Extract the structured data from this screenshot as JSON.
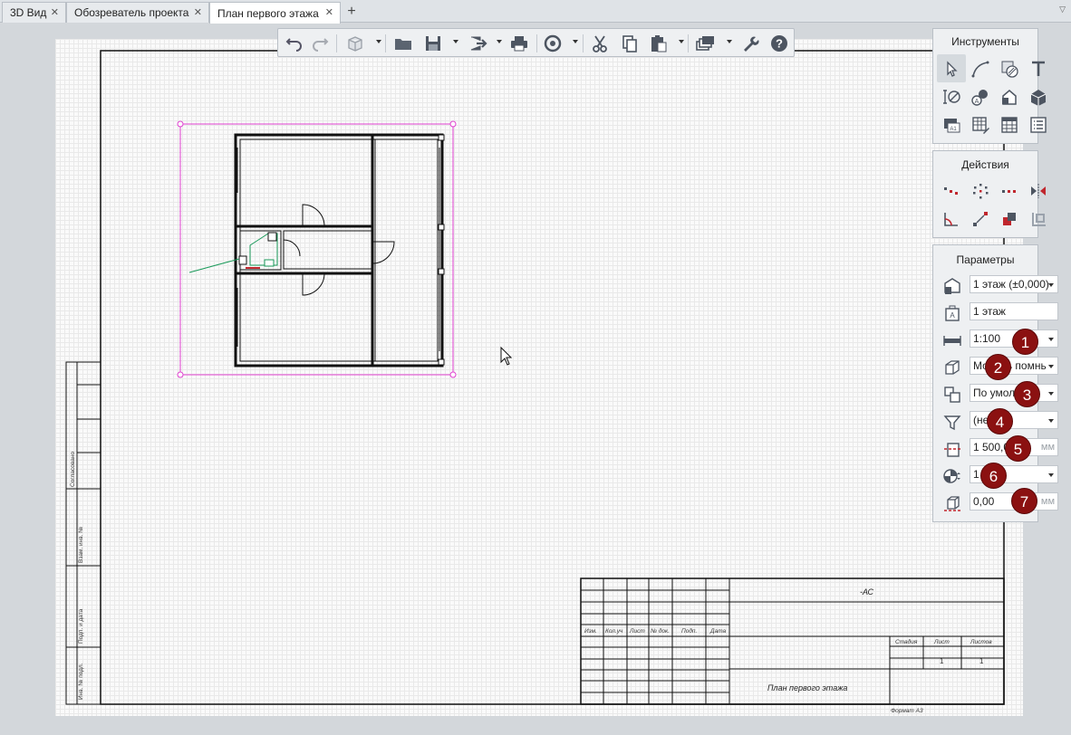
{
  "tabs": [
    {
      "label": "3D Вид",
      "close": "✕"
    },
    {
      "label": "Обозреватель проекта",
      "close": "✕"
    },
    {
      "label": "План первого этажа",
      "close": "✕",
      "active": true
    }
  ],
  "tab_add": "+",
  "tab_menu": "▽",
  "toolbar": {
    "icons": [
      "undo-icon",
      "redo-icon",
      "3d-box-icon",
      "open-folder-icon",
      "save-icon",
      "export-icon",
      "print-icon",
      "sync-icon",
      "cut-icon",
      "copy-icon",
      "paste-icon",
      "views-icon",
      "settings-wrench-icon",
      "help-icon"
    ]
  },
  "tools_panel": {
    "title": "Инструменты",
    "icons": [
      "select-arrow-icon",
      "line-tool-icon",
      "hatch-tool-icon",
      "text-tool-icon",
      "dimension-icon",
      "annotation-icon",
      "elevation-mark-icon",
      "building-3d-icon",
      "sheet-label-icon",
      "table-edit-icon",
      "table-icon",
      "list-icon"
    ]
  },
  "actions_panel": {
    "title": "Действия",
    "icons": [
      "move-icon",
      "rotate-copy-icon",
      "array-icon",
      "mirror-icon",
      "angle-icon",
      "scale-icon",
      "union-icon",
      "offset-icon"
    ]
  },
  "params_panel": {
    "title": "Параметры",
    "rows": [
      {
        "icon": "floor-level-icon",
        "value": "1 этаж (±0,000)",
        "type": "select"
      },
      {
        "icon": "label-icon",
        "value": "1 этаж",
        "type": "text"
      },
      {
        "icon": "scale-ruler-icon",
        "value": "1:100",
        "type": "select"
      },
      {
        "icon": "model-box-icon",
        "value": "Модель помнь",
        "type": "select"
      },
      {
        "icon": "view-template-icon",
        "value": "По умолч",
        "type": "select"
      },
      {
        "icon": "filter-icon",
        "value": "(нет)",
        "type": "select"
      },
      {
        "icon": "cut-height-icon",
        "value": "1 500,00",
        "type": "unit",
        "unit": "мм"
      },
      {
        "icon": "detail-level-icon",
        "value": "1",
        "type": "select"
      },
      {
        "icon": "depth-icon",
        "value": "0,00",
        "type": "unit",
        "unit": "мм"
      }
    ]
  },
  "badges": [
    "1",
    "2",
    "3",
    "4",
    "5",
    "6",
    "7"
  ],
  "colors": {
    "badge": "#8b1111",
    "selection": "#e040d0",
    "accent_green": "#1a9a5a"
  },
  "title_block": {
    "code": "-АС",
    "sheet_name": "План первого этажа",
    "format": "Формат А3",
    "stage_header": "Стадия",
    "sheet_header": "Лист",
    "sheets_header": "Листов",
    "sheet_no": "1",
    "sheets_total": "1",
    "col_headers": [
      "Изм.",
      "Кол.уч",
      "Лист",
      "№ док.",
      "Подп.",
      "Дата"
    ],
    "side_labels": [
      "Согласовано",
      "Взам. инв. №",
      "Подп. и дата",
      "Инв. № подл."
    ]
  }
}
